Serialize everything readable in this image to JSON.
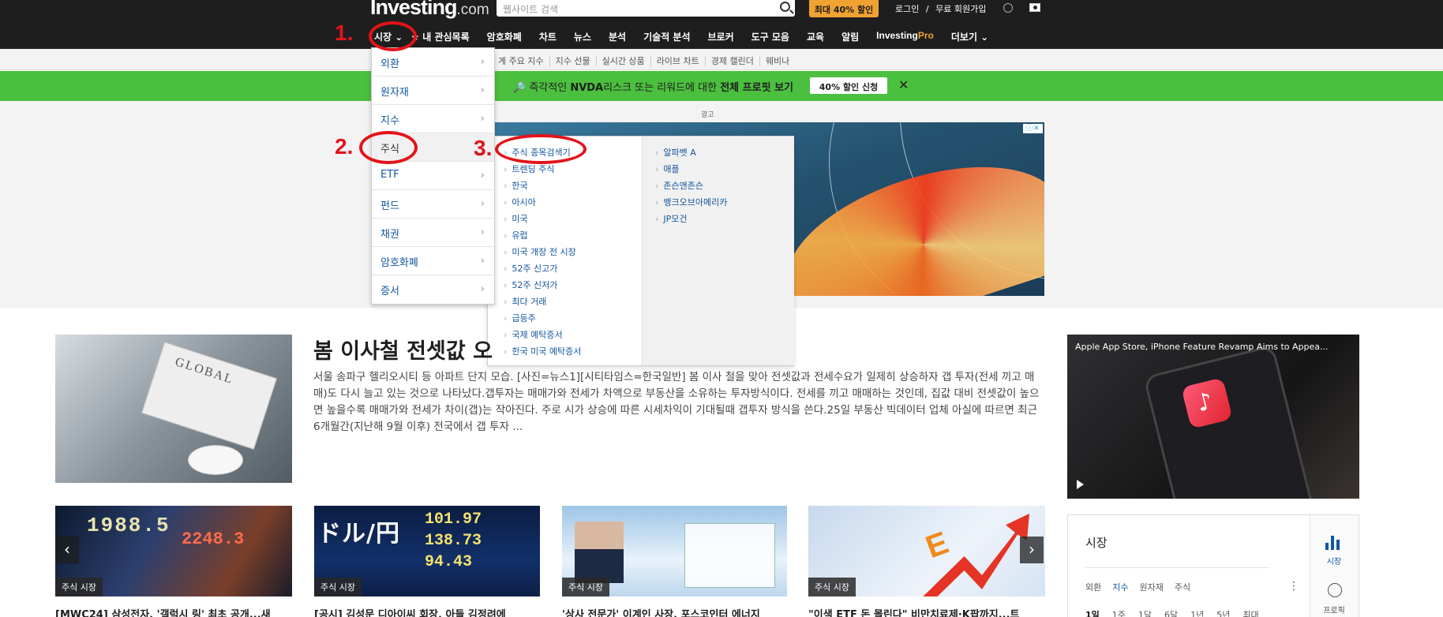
{
  "header": {
    "logo_main": "Investing",
    "logo_suffix": ".com",
    "search_placeholder": "웹사이트 검색",
    "promo_label": "최대 40% 할인",
    "login_label": "로그인",
    "separator": "/",
    "signup_label": "무료 회원가입"
  },
  "main_nav": [
    {
      "label": "시장 ⌄"
    },
    {
      "label": "★ 내 관심목록"
    },
    {
      "label": "암호화폐"
    },
    {
      "label": "차트"
    },
    {
      "label": "뉴스"
    },
    {
      "label": "분석"
    },
    {
      "label": "기술적 분석"
    },
    {
      "label": "브로커"
    },
    {
      "label": "도구 모음"
    },
    {
      "label": "교육"
    },
    {
      "label": "알림"
    },
    {
      "label_a": "Investing",
      "label_b": "Pro"
    },
    {
      "label": "더보기 ⌄"
    }
  ],
  "sub_nav": [
    "계 주요 지수",
    "지수 선물",
    "실시간 상품",
    "라이브 차트",
    "경제 캘린더",
    "웨비나"
  ],
  "banner": {
    "icon": "🔎",
    "text_a": "즉각적인",
    "text_b": "NVDA",
    "text_c": "리스크 또는 리워드에 대한",
    "text_d": "전체 프로핏 보기",
    "cta": "40% 할인 신청",
    "close": "✕"
  },
  "ad": {
    "label": "광고",
    "badge": "ⓘ✕"
  },
  "markets_menu": [
    {
      "label": "외환"
    },
    {
      "label": "원자재"
    },
    {
      "label": "지수"
    },
    {
      "label": "주식"
    },
    {
      "label": "ETF"
    },
    {
      "label": "펀드"
    },
    {
      "label": "채권"
    },
    {
      "label": "암호화폐"
    },
    {
      "label": "증서"
    }
  ],
  "stocks_submenu": {
    "col1": [
      "주식 종목검색기",
      "트렌딩 주식",
      "한국",
      "아시아",
      "미국",
      "유럽",
      "미국 개장 전 시장",
      "52주 신고가",
      "52주 신저가",
      "최다 거래",
      "급등주",
      "국제 예탁증서",
      "한국 미국 예탁증서"
    ],
    "col2": [
      "알파벳 A",
      "애플",
      "존슨앤존슨",
      "뱅크오브아메리카",
      "JP모건"
    ]
  },
  "annotations": [
    "1.",
    "2.",
    "3."
  ],
  "featured": {
    "title": "봄 이사철 전셋값 오",
    "body": "서울 송파구 헬리오시티 등 아파트 단지 모습. [사진=뉴스1][시티타임스=한국일반] 봄 이사 철을 맞아 전셋값과 전세수요가 일제히 상승하자 갭 투자(전세 끼고 매매)도 다시 늘고 있는 것으로 나타났다.갭투자는 매매가와 전세가 차액으로 부동산을 소유하는 투자방식이다. 전세를 끼고 매매하는 것인데, 집값 대비 전셋값이 높으면 높을수록 매매가와 전세가 차이(갭)는 작아진다. 주로 시가 상승에 따른 시세차익이 기대될때 갭투자 방식을 쓴다.25일 부동산 빅데이터 업체 아실에 따르면 최근 6개월간(지난해 9월 이후) 전국에서 갭 투자 ..."
  },
  "video": {
    "title": "Apple App Store, iPhone Feature Revamp Aims to Appea..."
  },
  "cards": [
    {
      "tag": "주식 시장",
      "title": "[MWC24] 삼성전자, '갤럭시 링' 최초 공개...새",
      "img_a": "1988.5",
      "img_b": "2248.3"
    },
    {
      "tag": "주식 시장",
      "title": "[공시] 김성문 디아이씨 회장, 아들 김정려에",
      "img_a": "ドル/円",
      "img_b": "101.97\n138.73\n94.43"
    },
    {
      "tag": "주식 시장",
      "title": "'상사 전문가' 이계인 사장, 포스코인터 에너지"
    },
    {
      "tag": "주식 시장",
      "title": "\"이색 ETF 돈 몰린다\" 비만치료제·K팝까지...트",
      "img_a": "E"
    }
  ],
  "carousel": {
    "prev": "‹",
    "next": "›"
  },
  "markets_widget": {
    "title": "시장",
    "tabs": [
      "외환",
      "지수",
      "원자재",
      "주식"
    ],
    "more": "⋮",
    "periods": [
      "1일",
      "1주",
      "1달",
      "6달",
      "1년",
      "5년",
      "최대"
    ],
    "side_chart_label": "시장",
    "side_pro_label": "프로픽"
  }
}
